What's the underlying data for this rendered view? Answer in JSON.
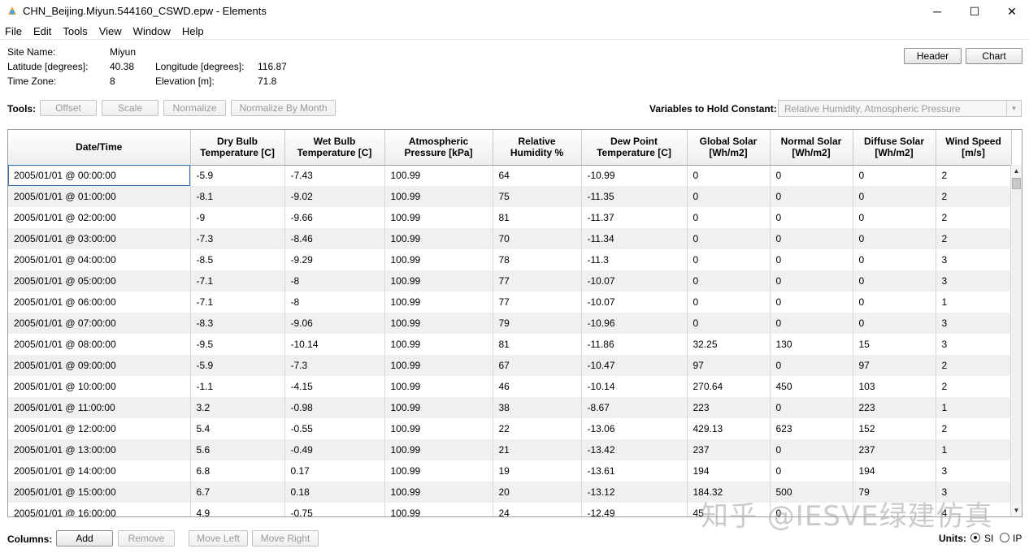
{
  "window": {
    "title": "CHN_Beijing.Miyun.544160_CSWD.epw - Elements",
    "minimize": "─",
    "maximize": "☐",
    "close": "✕"
  },
  "menu": [
    "File",
    "Edit",
    "Tools",
    "View",
    "Window",
    "Help"
  ],
  "site": {
    "name_label": "Site Name:",
    "name_value": "Miyun",
    "lat_label": "Latitude [degrees]:",
    "lat_value": "40.38",
    "lon_label": "Longitude [degrees]:",
    "lon_value": "116.87",
    "tz_label": "Time Zone:",
    "tz_value": "8",
    "elev_label": "Elevation [m]:",
    "elev_value": "71.8"
  },
  "top_buttons": {
    "header": "Header",
    "chart": "Chart"
  },
  "tools": {
    "label": "Tools:",
    "offset": "Offset",
    "scale": "Scale",
    "normalize": "Normalize",
    "normalize_by_month": "Normalize By Month",
    "hold_label": "Variables to Hold Constant:",
    "hold_value": "Relative Humidity, Atmospheric Pressure"
  },
  "table": {
    "headers": [
      "Date/Time",
      "Dry Bulb\nTemperature [C]",
      "Wet Bulb\nTemperature [C]",
      "Atmospheric\nPressure [kPa]",
      "Relative\nHumidity %",
      "Dew Point\nTemperature [C]",
      "Global Solar\n[Wh/m2]",
      "Normal Solar\n[Wh/m2]",
      "Diffuse Solar\n[Wh/m2]",
      "Wind Speed\n[m/s]"
    ],
    "rows": [
      [
        "2005/01/01 @ 00:00:00",
        "-5.9",
        "-7.43",
        "100.99",
        "64",
        "-10.99",
        "0",
        "0",
        "0",
        "2"
      ],
      [
        "2005/01/01 @ 01:00:00",
        "-8.1",
        "-9.02",
        "100.99",
        "75",
        "-11.35",
        "0",
        "0",
        "0",
        "2"
      ],
      [
        "2005/01/01 @ 02:00:00",
        "-9",
        "-9.66",
        "100.99",
        "81",
        "-11.37",
        "0",
        "0",
        "0",
        "2"
      ],
      [
        "2005/01/01 @ 03:00:00",
        "-7.3",
        "-8.46",
        "100.99",
        "70",
        "-11.34",
        "0",
        "0",
        "0",
        "2"
      ],
      [
        "2005/01/01 @ 04:00:00",
        "-8.5",
        "-9.29",
        "100.99",
        "78",
        "-11.3",
        "0",
        "0",
        "0",
        "3"
      ],
      [
        "2005/01/01 @ 05:00:00",
        "-7.1",
        "-8",
        "100.99",
        "77",
        "-10.07",
        "0",
        "0",
        "0",
        "3"
      ],
      [
        "2005/01/01 @ 06:00:00",
        "-7.1",
        "-8",
        "100.99",
        "77",
        "-10.07",
        "0",
        "0",
        "0",
        "1"
      ],
      [
        "2005/01/01 @ 07:00:00",
        "-8.3",
        "-9.06",
        "100.99",
        "79",
        "-10.96",
        "0",
        "0",
        "0",
        "3"
      ],
      [
        "2005/01/01 @ 08:00:00",
        "-9.5",
        "-10.14",
        "100.99",
        "81",
        "-11.86",
        "32.25",
        "130",
        "15",
        "3"
      ],
      [
        "2005/01/01 @ 09:00:00",
        "-5.9",
        "-7.3",
        "100.99",
        "67",
        "-10.47",
        "97",
        "0",
        "97",
        "2"
      ],
      [
        "2005/01/01 @ 10:00:00",
        "-1.1",
        "-4.15",
        "100.99",
        "46",
        "-10.14",
        "270.64",
        "450",
        "103",
        "2"
      ],
      [
        "2005/01/01 @ 11:00:00",
        "3.2",
        "-0.98",
        "100.99",
        "38",
        "-8.67",
        "223",
        "0",
        "223",
        "1"
      ],
      [
        "2005/01/01 @ 12:00:00",
        "5.4",
        "-0.55",
        "100.99",
        "22",
        "-13.06",
        "429.13",
        "623",
        "152",
        "2"
      ],
      [
        "2005/01/01 @ 13:00:00",
        "5.6",
        "-0.49",
        "100.99",
        "21",
        "-13.42",
        "237",
        "0",
        "237",
        "1"
      ],
      [
        "2005/01/01 @ 14:00:00",
        "6.8",
        "0.17",
        "100.99",
        "19",
        "-13.61",
        "194",
        "0",
        "194",
        "3"
      ],
      [
        "2005/01/01 @ 15:00:00",
        "6.7",
        "0.18",
        "100.99",
        "20",
        "-13.12",
        "184.32",
        "500",
        "79",
        "3"
      ],
      [
        "2005/01/01 @ 16:00:00",
        "4.9",
        "-0.75",
        "100.99",
        "24",
        "-12.49",
        "45",
        "0",
        "",
        "4"
      ]
    ]
  },
  "columns_bar": {
    "label": "Columns:",
    "add": "Add",
    "remove": "Remove",
    "move_left": "Move Left",
    "move_right": "Move Right"
  },
  "units": {
    "label": "Units:",
    "si": "SI",
    "ip": "IP",
    "selected": "SI"
  },
  "watermark": "知乎 @IESVE绿建仿真"
}
